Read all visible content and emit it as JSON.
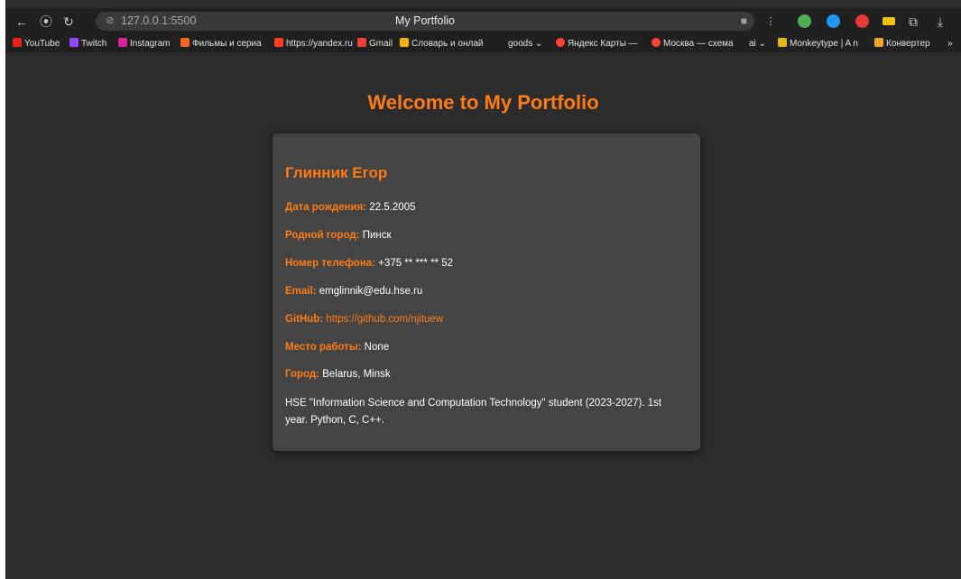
{
  "browser": {
    "url": "127.0.0.1:5500",
    "tab_title": "My Portfolio"
  },
  "bookmarks": [
    {
      "label": "YouTube",
      "color": "#e62117"
    },
    {
      "label": "Twitch",
      "color": "#9146ff"
    },
    {
      "label": "Instagram",
      "color": "#d6249f"
    },
    {
      "label": "Фильмы и сериа",
      "color": "#f26722"
    },
    {
      "label": "https://yandex.ru",
      "color": "#fc3f1d"
    },
    {
      "label": "Gmail",
      "color": "#ea4335"
    },
    {
      "label": "Словарь и онлай",
      "color": "#f4b400"
    },
    {
      "label": "goods",
      "color": ""
    },
    {
      "label": "Яндекс Карты —",
      "color": "#ff4433"
    },
    {
      "label": "Москва — схема",
      "color": "#ff4433"
    },
    {
      "label": "ai",
      "color": ""
    },
    {
      "label": "Monkeytype | A n",
      "color": "#e2b714"
    },
    {
      "label": "Конвертер",
      "color": "#f5a623"
    }
  ],
  "page": {
    "heading": "Welcome to My Portfolio",
    "name": "Глинник Егор",
    "fields": [
      {
        "label": "Дата рождения:",
        "value": "22.5.2005"
      },
      {
        "label": "Родной город:",
        "value": "Пинск"
      },
      {
        "label": "Номер телефона:",
        "value": "+375 ** *** ** 52"
      },
      {
        "label": "Email:",
        "value": "emglinnik@edu.hse.ru"
      },
      {
        "label": "GitHub:",
        "value": "https://github.com/njituew"
      },
      {
        "label": "Место работы:",
        "value": "None"
      },
      {
        "label": "Город:",
        "value": "Belarus, Minsk"
      }
    ],
    "bio": "HSE \"Information Science and Computation Technology\" student (2023-2027). 1st year. Python, C, C++."
  },
  "colors": {
    "accent": "#ff7b14",
    "page_bg": "#2c2c2c",
    "card_bg": "#444444"
  }
}
